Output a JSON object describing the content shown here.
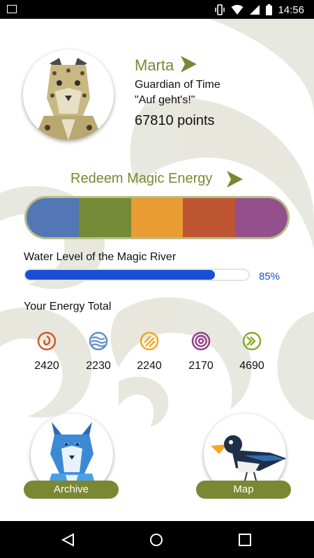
{
  "status_bar": {
    "time": "14:56"
  },
  "profile": {
    "name": "Marta",
    "title": "Guardian of Time",
    "quote": "\"Auf geht's!\"",
    "points": "67810 points"
  },
  "redeem": {
    "label": "Redeem Magic Energy",
    "segment_colors": [
      "#5377b5",
      "#758a36",
      "#e89c33",
      "#be5634",
      "#94508c"
    ]
  },
  "water": {
    "label": "Water Level of the Magic River",
    "percent_value": 85,
    "percent_text": "85%"
  },
  "energy_total": {
    "label": "Your Energy Total",
    "items": [
      {
        "icon": "fire-spiral-icon",
        "color": "#d0572b",
        "value": "2420"
      },
      {
        "icon": "water-waves-icon",
        "color": "#5f8fc8",
        "value": "2230"
      },
      {
        "icon": "sun-stripes-icon",
        "color": "#f0a71f",
        "value": "2240"
      },
      {
        "icon": "purple-spiral-icon",
        "color": "#93428e",
        "value": "2170"
      },
      {
        "icon": "earth-chevrons-icon",
        "color": "#8aaa2c",
        "value": "4690"
      }
    ]
  },
  "buttons": {
    "archive": "Archive",
    "map": "Map"
  },
  "colors": {
    "accent": "#7a8834",
    "progress": "#1a4fd4"
  }
}
